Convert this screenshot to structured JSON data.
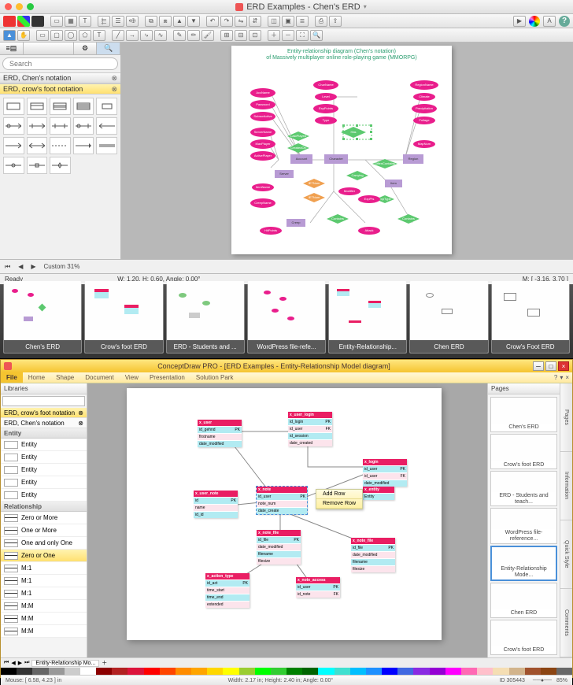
{
  "mac": {
    "title": "ERD Examples - Chen's ERD",
    "search_placeholder": "Search",
    "libraries": [
      {
        "name": "ERD, Chen's notation",
        "selected": false
      },
      {
        "name": "ERD, crow's foot notation",
        "selected": true
      }
    ],
    "zoom_label": "Custom 31%",
    "status_ready": "Ready",
    "status_dims": "W: 1.20,  H: 0.60,  Angle: 0.00°",
    "status_mouse": "M: [ -3.16, 3.70 ]",
    "erd": {
      "title_line1": "Entity-relationship diagram (Chen's notation)",
      "title_line2": "of Massively multiplayer online role-playing game (MMORPG)",
      "attributes_left": [
        "AccName",
        "Password",
        "SubscrActive",
        "ServerName",
        "MaxPlayer",
        "ActivePlayer",
        "CreepName"
      ],
      "attributes_top": [
        "CharName",
        "Level",
        "ExpPoints",
        "Type"
      ],
      "attributes_right": [
        "RegionName",
        "Climate",
        "Precipitation",
        "Foliage",
        "MapNum"
      ],
      "entities": [
        "Account",
        "Server",
        "Character",
        "Item",
        "Creep",
        "Region"
      ],
      "relationships": [
        "LastPlayed",
        "CreatedOn",
        "Has",
        "IETNum",
        "Carrying",
        "OftenContains",
        "Contains",
        "IETNum",
        "Contains",
        "ExpType"
      ],
      "weak_attrs": [
        "ItemName",
        "Modifier",
        "ItemName",
        "Modifier",
        "CName",
        "ExpPts",
        "HitPoints",
        "Attack"
      ]
    }
  },
  "thumbnails": [
    "Chen's ERD",
    "Crow's foot ERD",
    "ERD - Students and ...",
    "WordPress file-refe...",
    "Entity-Relationship...",
    "Chen ERD",
    "Crow's Foot ERD"
  ],
  "win": {
    "title": "ConceptDraw PRO - [ERD Examples - Entity-Relationship Model diagram]",
    "ribbon_tabs": [
      "File",
      "Home",
      "Shape",
      "Document",
      "View",
      "Presentation",
      "Solution Park"
    ],
    "libraries_label": "Libraries",
    "pages_label": "Pages",
    "search_placeholder": "",
    "lib_items": [
      {
        "name": "ERD, crow's foot notation",
        "selected": true
      },
      {
        "name": "ERD, Chen's notation",
        "selected": false
      }
    ],
    "section_entity": "Entity",
    "entity_rows": [
      "Entity",
      "Entity",
      "Entity",
      "Entity",
      "Entity"
    ],
    "section_relationship": "Relationship",
    "rel_rows": [
      "Zero or More",
      "One or More",
      "One and only One",
      "Zero or One",
      "M:1",
      "M:1",
      "M:1",
      "M:M",
      "M:M",
      "M:M"
    ],
    "rel_highlight_index": 3,
    "context_menu": [
      "Add Row",
      "Remove Row"
    ],
    "tables": {
      "t1": {
        "name": "x_user",
        "rows": [
          [
            "id_gehnd",
            "PK"
          ],
          [
            "firstname",
            ""
          ],
          [
            "date_modified",
            ""
          ]
        ]
      },
      "t2": {
        "name": "x_user_login",
        "rows": [
          [
            "id_login",
            "PK"
          ],
          [
            "id_user",
            "FK"
          ],
          [
            "id_session",
            ""
          ],
          [
            "date_created",
            ""
          ]
        ]
      },
      "t3": {
        "name": "x_login",
        "rows": [
          [
            "id_user",
            "PK"
          ],
          [
            "id_user",
            "FK"
          ],
          [
            "date_modified",
            ""
          ]
        ]
      },
      "t4": {
        "name": "x_entity",
        "rows": [
          [
            "Entity",
            ""
          ]
        ]
      },
      "t5": {
        "name": "x_note",
        "rows": [
          [
            "id_user",
            "PK"
          ],
          [
            "note_num",
            ""
          ],
          [
            "date_create",
            ""
          ]
        ]
      },
      "t6": {
        "name": "x_user_note",
        "rows": [
          [
            "id",
            "PK"
          ],
          [
            "name",
            ""
          ],
          [
            "id_id",
            ""
          ]
        ]
      },
      "t7": {
        "name": "x_note_file",
        "rows": [
          [
            "id_file",
            "PK"
          ],
          [
            "date_modified",
            ""
          ],
          [
            "filename",
            ""
          ],
          [
            "filesize",
            ""
          ]
        ]
      },
      "t8": {
        "name": "x_action_type",
        "rows": [
          [
            "id_act",
            "PK"
          ],
          [
            "time_start",
            ""
          ],
          [
            "time_end",
            ""
          ],
          [
            "extended",
            ""
          ]
        ]
      },
      "t9": {
        "name": "x_note_access",
        "rows": [
          [
            "id_user",
            "PK"
          ],
          [
            "id_note",
            "FK"
          ]
        ]
      }
    },
    "page_thumbs": [
      "Chen's ERD",
      "Crow's foot ERD",
      "ERD - Students and teach...",
      "WordPress file-reference...",
      "Entity-Relationship Mode...",
      "Chen ERD",
      "Crow's foot ERD"
    ],
    "active_page_index": 4,
    "vtabs": [
      "Pages",
      "Information",
      "Quick Style",
      "Comments"
    ],
    "bottom_tab": "Entity-Relationship Mo...",
    "status_mouse": "Mouse: [ 6.58, 4.23 ] in",
    "status_dims": "Width: 2.17 in; Height: 2.40 in; Angle: 0.00°",
    "status_obj": "ID 305443",
    "status_zoom": "85%"
  },
  "colors": [
    "#000",
    "#333",
    "#666",
    "#999",
    "#ccc",
    "#fff",
    "#8b0000",
    "#b22222",
    "#dc143c",
    "#ff0000",
    "#ff4500",
    "#ff8c00",
    "#ffa500",
    "#ffd700",
    "#ffff00",
    "#9acd32",
    "#00ff00",
    "#32cd32",
    "#008000",
    "#006400",
    "#00ffff",
    "#40e0d0",
    "#00bfff",
    "#1e90ff",
    "#0000ff",
    "#4169e1",
    "#8a2be2",
    "#9400d3",
    "#ff00ff",
    "#ff69b4",
    "#ffc0cb",
    "#f5deb3",
    "#d2b48c",
    "#a0522d",
    "#8b4513",
    "#696969"
  ]
}
